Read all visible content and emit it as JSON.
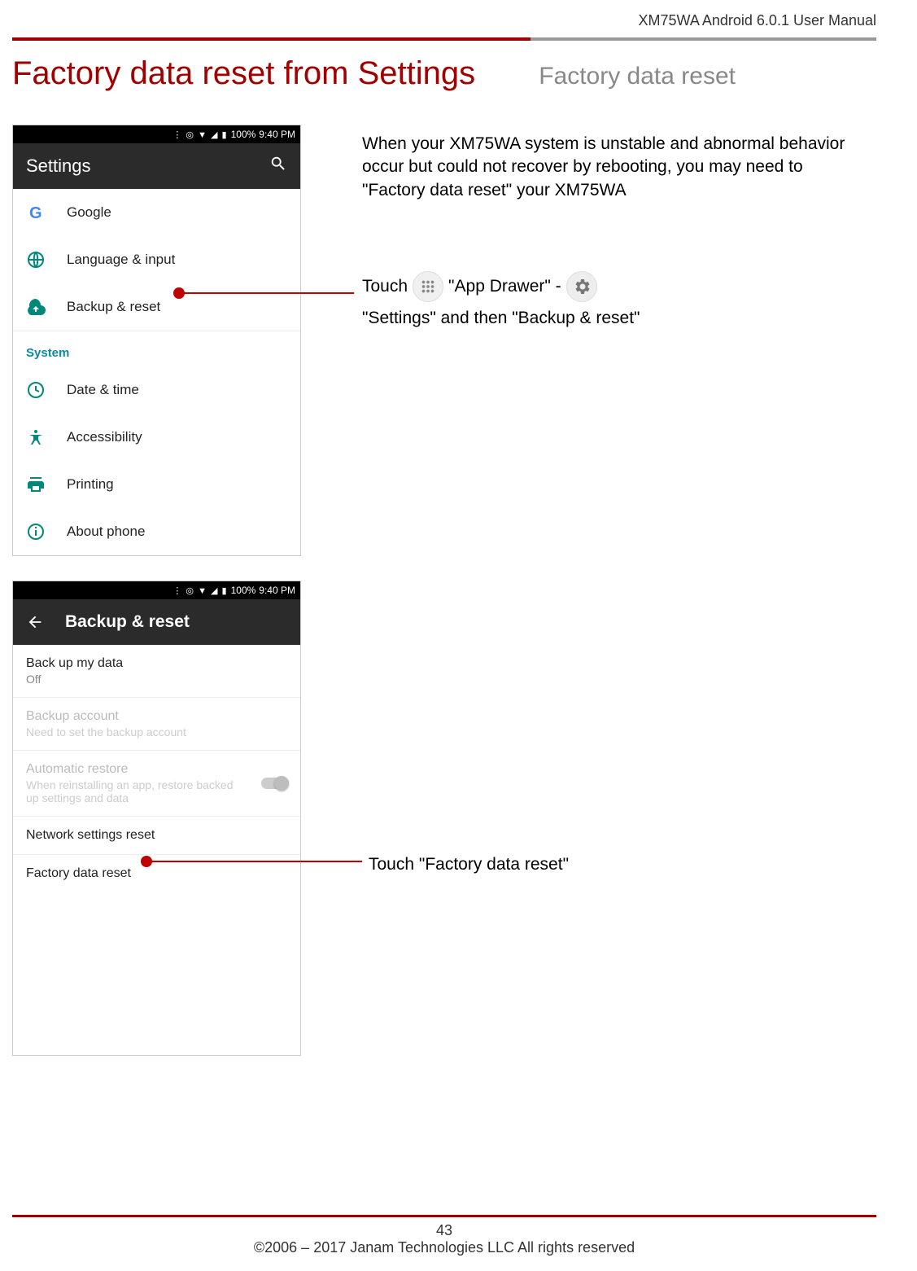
{
  "doc": {
    "header": "XM75WA Android 6.0.1 User Manual",
    "title_left": "Factory data reset from Settings",
    "title_right": "Factory data reset",
    "page_number": "43",
    "copyright": "©2006 – 2017 Janam Technologies LLC All rights reserved"
  },
  "statusbar": {
    "icons": "⋮ ◎ ▼ ◢ ▮",
    "battery": "100%",
    "time": "9:40 PM"
  },
  "settings": {
    "title": "Settings",
    "section_header": "System",
    "items": [
      {
        "label": "Google"
      },
      {
        "label": "Language & input"
      },
      {
        "label": "Backup & reset"
      },
      {
        "label": "Date & time"
      },
      {
        "label": "Accessibility"
      },
      {
        "label": "Printing"
      },
      {
        "label": "About phone"
      }
    ]
  },
  "backup": {
    "title": "Backup & reset",
    "items": {
      "backup_data": {
        "t1": "Back up my data",
        "t2": "Off"
      },
      "backup_account": {
        "t1": "Backup account",
        "t2": "Need to set the backup account"
      },
      "auto_restore": {
        "t1": "Automatic restore",
        "t2": "When reinstalling an app, restore backed up settings and data"
      },
      "network_reset": {
        "t1": "Network settings reset"
      },
      "factory_reset": {
        "t1": "Factory data reset"
      }
    }
  },
  "paragraphs": {
    "p1": "When your XM75WA system is unstable and abnormal behavior occur but could not recover by rebooting, you may need to \"Factory data reset\" your XM75WA",
    "p2_a": "Touch",
    "p2_b": "\"App Drawer\" -",
    "p2_c": "\"Settings\" and then \"Backup & reset\"",
    "p3": "Touch \"Factory data reset\""
  }
}
